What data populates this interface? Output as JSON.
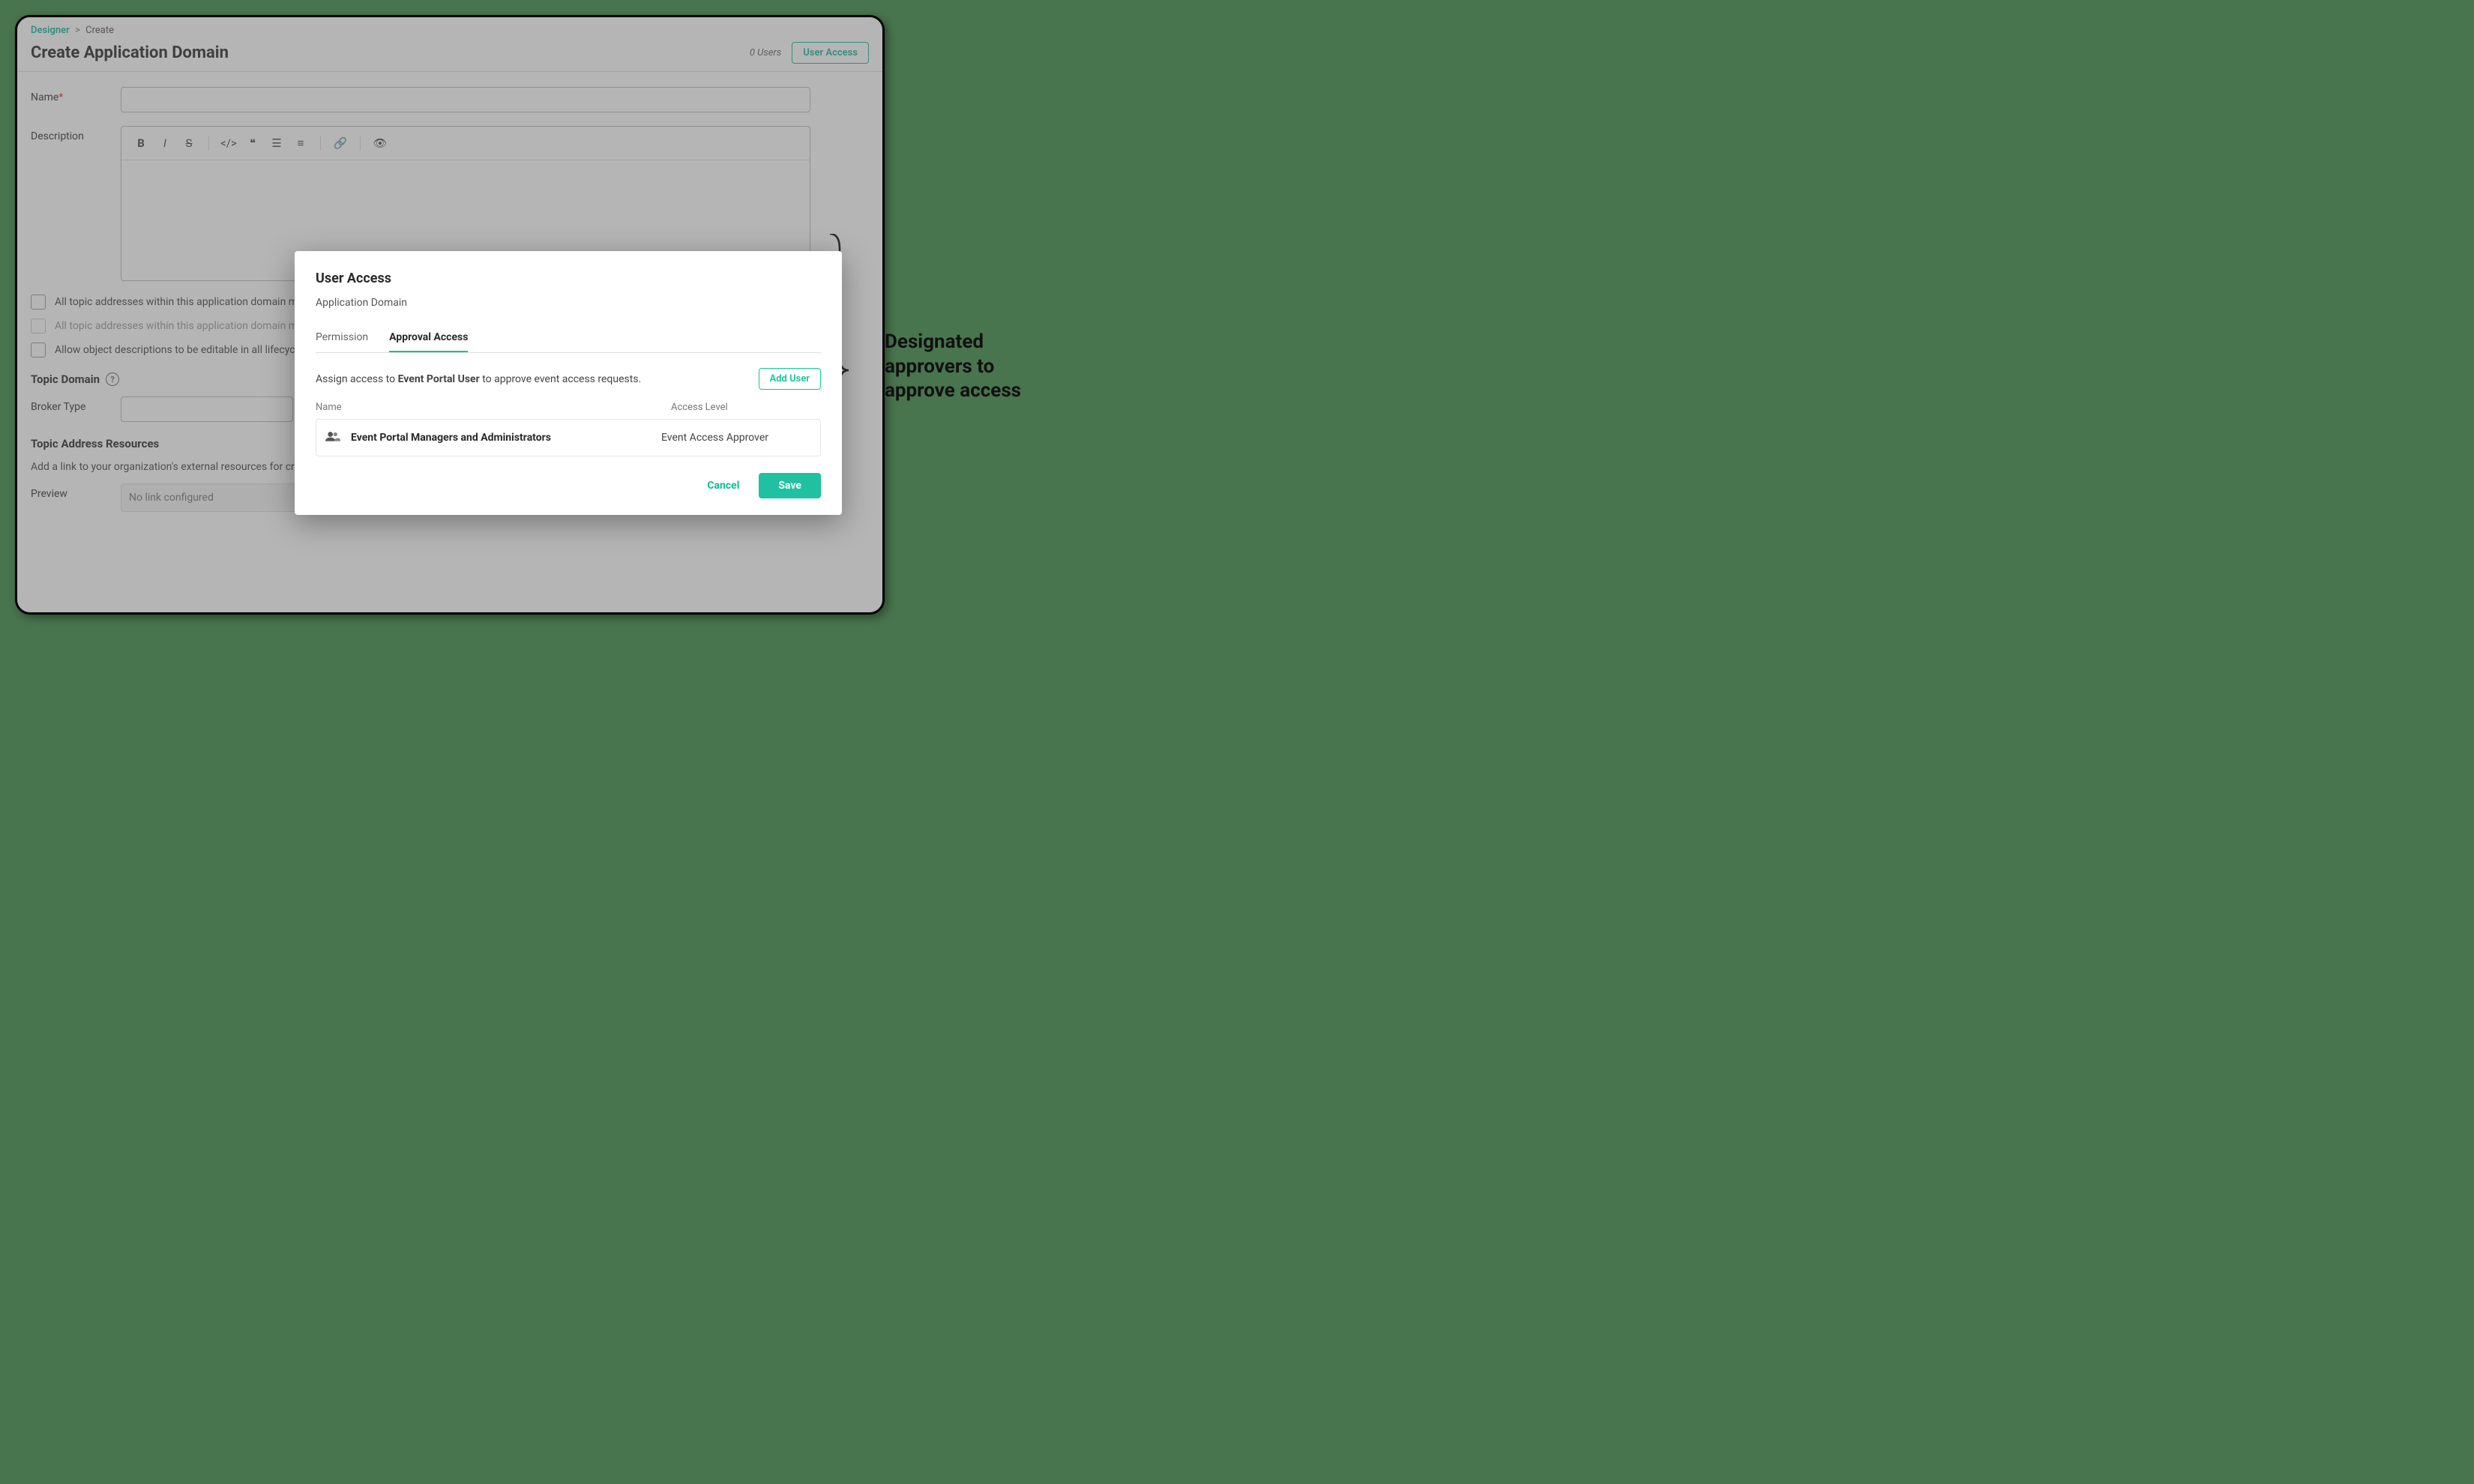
{
  "breadcrumb": {
    "root": "Designer",
    "current": "Create"
  },
  "header": {
    "title": "Create Application Domain",
    "user_count": "0 Users",
    "user_access_btn": "User Access"
  },
  "form": {
    "name_label": "Name",
    "desc_label": "Description",
    "checkboxes": [
      "All topic addresses within this application domain must be unique",
      "All topic addresses within this application domain must start with one of the domain's topic domains",
      "Allow object descriptions to be editable in all lifecycle states"
    ],
    "topic_domain_title": "Topic Domain",
    "broker_type_label": "Broker Type",
    "resources_title": "Topic Address Resources",
    "resources_desc": "Add a link to your organization's external resources for creating topic addresses.",
    "preview_label": "Preview",
    "preview_value": "No link configured"
  },
  "modal": {
    "title": "User Access",
    "subtitle": "Application Domain",
    "tabs": [
      "Permission",
      "Approval Access"
    ],
    "active_tab": 1,
    "instruction_pre": "Assign access to ",
    "instruction_bold": "Event Portal User",
    "instruction_post": " to approve event access requests.",
    "add_user_btn": "Add User",
    "cols": {
      "name": "Name",
      "level": "Access Level"
    },
    "rows": [
      {
        "name": "Event Portal Managers and Administrators",
        "level": "Event Access Approver"
      }
    ],
    "cancel": "Cancel",
    "save": "Save"
  },
  "callout": "Designated approvers to approve access"
}
